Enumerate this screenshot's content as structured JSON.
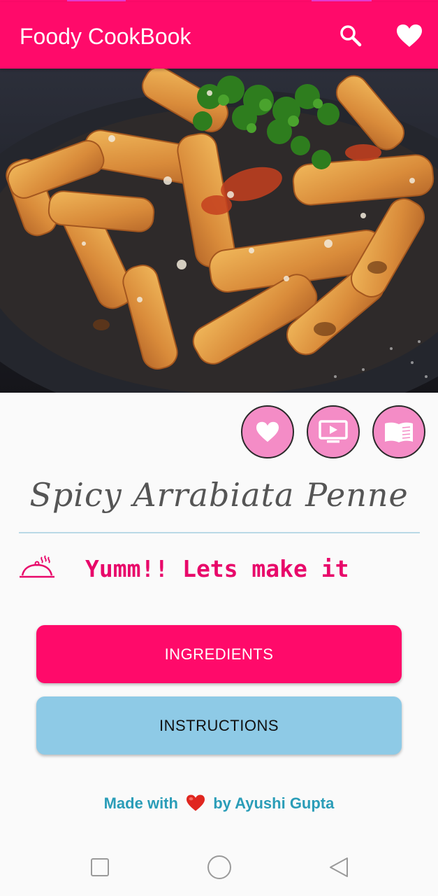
{
  "app_bar": {
    "title": "Foody CookBook",
    "icons": [
      "search-icon",
      "heart-icon"
    ]
  },
  "hero": {
    "alt": "penne pasta dish"
  },
  "action_icons": [
    "heart-icon",
    "video-icon",
    "book-icon"
  ],
  "recipe": {
    "title": "Spicy Arrabiata Penne",
    "tagline": "Yumm!! Lets make it",
    "tagline_icon": "cloche-icon"
  },
  "buttons": {
    "ingredients": "INGREDIENTS",
    "instructions": "INSTRUCTIONS"
  },
  "credit": {
    "prefix": "Made with",
    "suffix": "by Ayushi Gupta",
    "icon": "heart-emoji-icon"
  },
  "nav": [
    "recents-icon",
    "home-icon",
    "back-icon"
  ],
  "colors": {
    "primary": "#ff0a6a",
    "action_button": "#f48cc6",
    "instructions_button": "#8ecae6",
    "credit_text": "#2a9db8",
    "tagline_text": "#e8086a"
  }
}
